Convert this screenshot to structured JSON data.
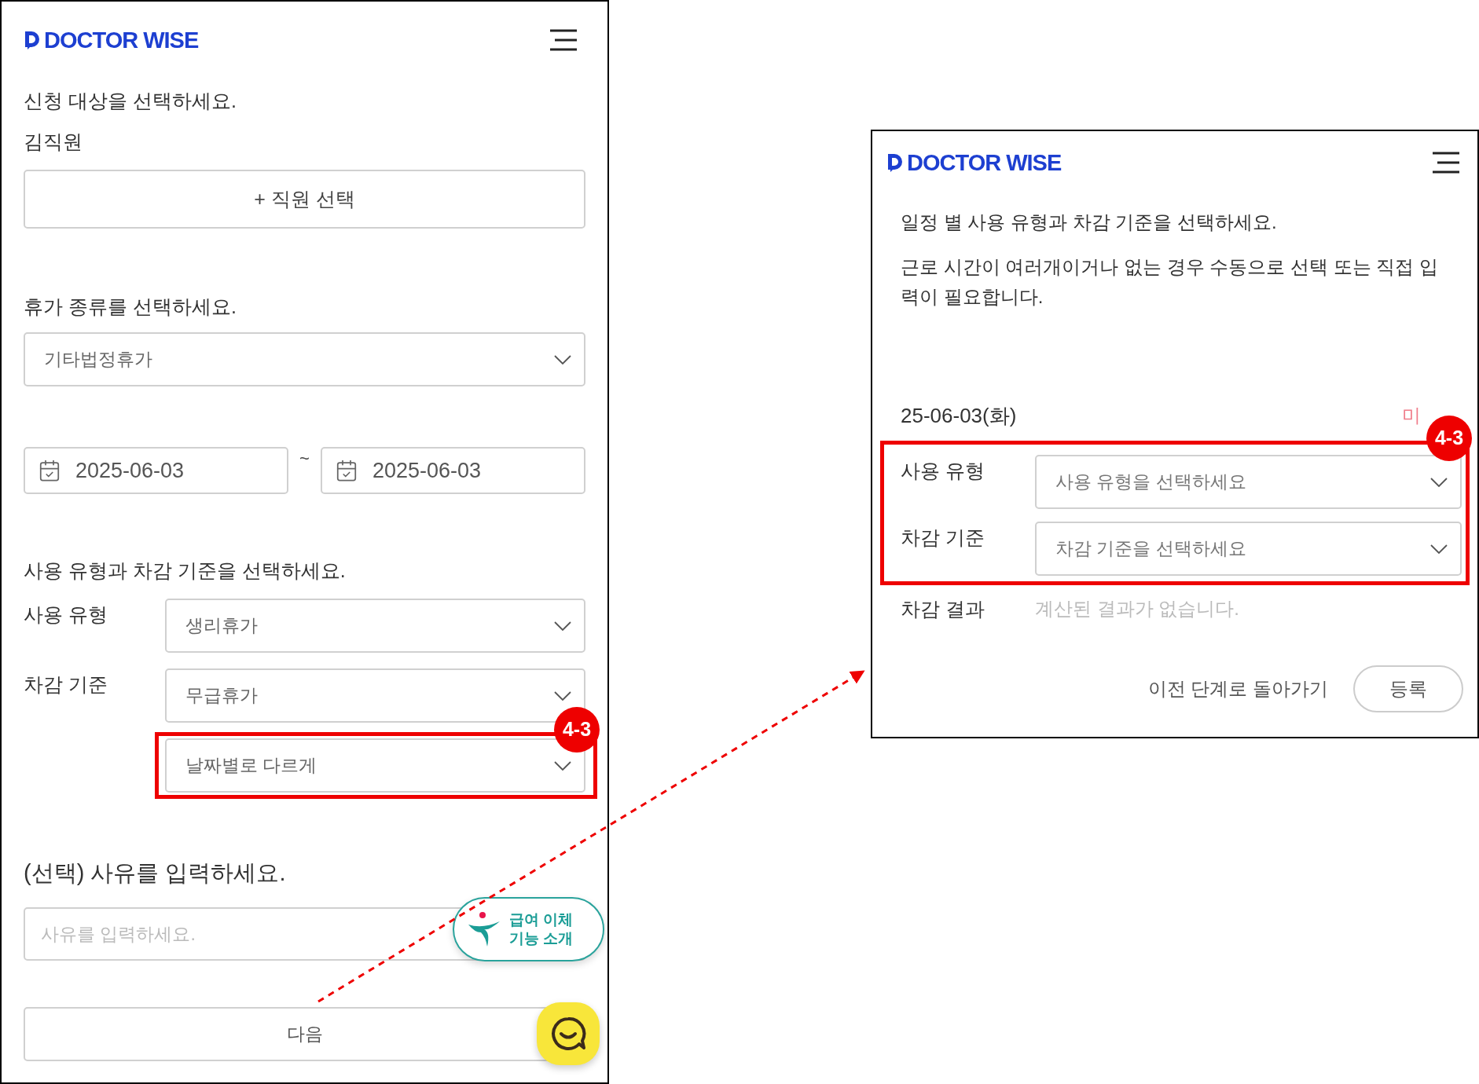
{
  "left_screen": {
    "logo": "DOCTOR WISE",
    "target_prompt": "신청 대상을 선택하세요.",
    "employee_name": "김직원",
    "add_employee_button": "+ 직원 선택",
    "leave_prompt": "휴가 종류를 선택하세요.",
    "leave_type": "기타법정휴가",
    "date_from": "2025-06-03",
    "date_separator": "~",
    "date_to": "2025-06-03",
    "usage_prompt": "사용 유형과 차감 기준을 선택하세요.",
    "fields": [
      {
        "label": "사용 유형",
        "value": "생리휴가",
        "highlighted": false
      },
      {
        "label": "차감 기준",
        "value": "무급휴가",
        "highlighted": false
      },
      {
        "value": "날짜별로 다르게",
        "highlighted": true
      }
    ],
    "annotation": "4-3",
    "reason_prompt": "(선택) 사유를 입력하세요.",
    "reason_placeholder": "사유를 입력하세요.",
    "next_button": "다음",
    "promo_lines": [
      "급여 이체",
      "기능 소개"
    ]
  },
  "right_screen": {
    "logo": "DOCTOR WISE",
    "instruction": "일정 별 사용 유형과 차감 기준을 선택하세요.",
    "note": "근로 시간이 여러개이거나 없는 경우 수동으로 선택 또는 직접 입력이 필요합니다.",
    "date": "25-06-03(화)",
    "status": "미",
    "fields_highlighted": true,
    "fields": [
      {
        "label": "사용 유형",
        "placeholder": "사용 유형을 선택하세요"
      },
      {
        "label": "차감 기준",
        "placeholder": "차감 기준을 선택하세요"
      }
    ],
    "annotation": "4-3",
    "result_label": "차감 결과",
    "result_text": "계산된 결과가 없습니다.",
    "back_link": "이전 단계로 돌아가기",
    "register_button": "등록"
  }
}
